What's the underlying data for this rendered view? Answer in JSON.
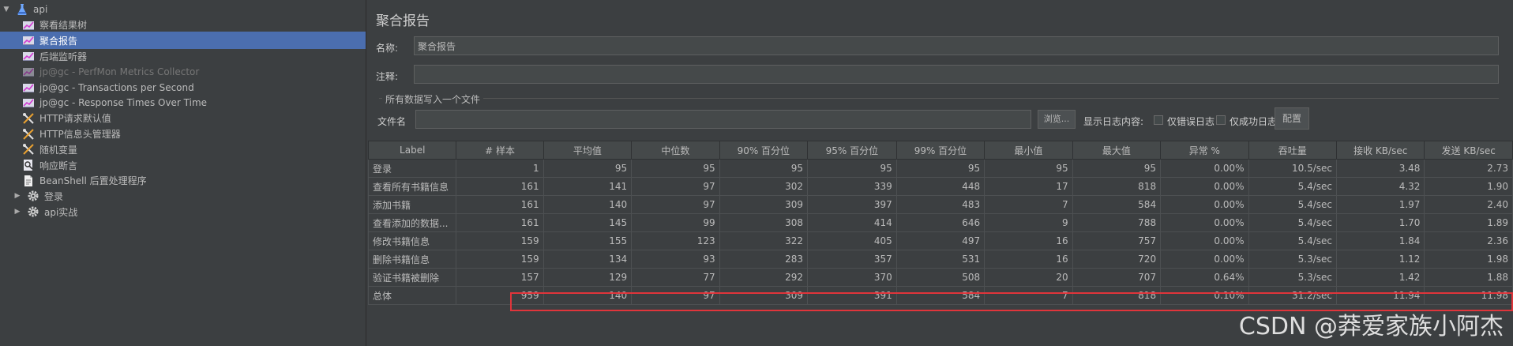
{
  "tree": [
    {
      "label": "api",
      "icon": "flask-icon",
      "name": "tree-root-api",
      "toggle": "▼",
      "indent": 0,
      "selected": false,
      "disabled": false
    },
    {
      "label": "察看结果树",
      "icon": "listener-graph-icon",
      "name": "tree-item-view-results-tree",
      "toggle": "",
      "indent": 28,
      "selected": false,
      "disabled": false
    },
    {
      "label": "聚合报告",
      "icon": "listener-graph-icon",
      "name": "tree-item-aggregate-report",
      "toggle": "",
      "indent": 28,
      "selected": true,
      "disabled": false
    },
    {
      "label": "后端监听器",
      "icon": "listener-graph-icon",
      "name": "tree-item-backend-listener",
      "toggle": "",
      "indent": 28,
      "selected": false,
      "disabled": false
    },
    {
      "label": "jp@gc - PerfMon Metrics Collector",
      "icon": "listener-graph-icon",
      "name": "tree-item-perfmon-collector",
      "toggle": "",
      "indent": 28,
      "selected": false,
      "disabled": true
    },
    {
      "label": "jp@gc - Transactions per Second",
      "icon": "listener-graph-icon",
      "name": "tree-item-transactions-per-second",
      "toggle": "",
      "indent": 28,
      "selected": false,
      "disabled": false
    },
    {
      "label": "jp@gc - Response Times Over Time",
      "icon": "listener-graph-icon",
      "name": "tree-item-response-times",
      "toggle": "",
      "indent": 28,
      "selected": false,
      "disabled": false
    },
    {
      "label": "HTTP请求默认值",
      "icon": "config-tools-icon",
      "name": "tree-item-http-defaults",
      "toggle": "",
      "indent": 28,
      "selected": false,
      "disabled": false
    },
    {
      "label": "HTTP信息头管理器",
      "icon": "config-tools-icon",
      "name": "tree-item-http-header-manager",
      "toggle": "",
      "indent": 28,
      "selected": false,
      "disabled": false
    },
    {
      "label": "随机变量",
      "icon": "config-tools-icon",
      "name": "tree-item-random-variable",
      "toggle": "",
      "indent": 28,
      "selected": false,
      "disabled": false
    },
    {
      "label": "响应断言",
      "icon": "assertion-icon",
      "name": "tree-item-response-assertion",
      "toggle": "",
      "indent": 28,
      "selected": false,
      "disabled": false
    },
    {
      "label": "BeanShell 后置处理程序",
      "icon": "script-icon",
      "name": "tree-item-beanshell-postprocessor",
      "toggle": "",
      "indent": 28,
      "selected": false,
      "disabled": false
    },
    {
      "label": "登录",
      "icon": "gear-icon",
      "name": "tree-item-login-group",
      "toggle": "▶",
      "indent": 16,
      "selected": false,
      "disabled": false
    },
    {
      "label": "api实战",
      "icon": "gear-icon",
      "name": "tree-item-api-practice-group",
      "toggle": "▶",
      "indent": 16,
      "selected": false,
      "disabled": false
    }
  ],
  "panel": {
    "title": "聚合报告",
    "name_label": "名称:",
    "name_value": "聚合报告",
    "comment_label": "注释:",
    "comment_value": "",
    "write_section": "所有数据写入一个文件",
    "filename_label": "文件名",
    "filename_value": "",
    "browse_button": "浏览...",
    "log_content_label": "显示日志内容:",
    "errors_only_label": "仅错误日志",
    "success_only_label": "仅成功日志",
    "configure_button": "配置"
  },
  "table": {
    "headers": [
      "Label",
      "# 样本",
      "平均值",
      "中位数",
      "90% 百分位",
      "95% 百分位",
      "99% 百分位",
      "最小值",
      "最大值",
      "异常 %",
      "吞吐量",
      "接收 KB/sec",
      "发送 KB/sec"
    ],
    "rows": [
      [
        "登录",
        "1",
        "95",
        "95",
        "95",
        "95",
        "95",
        "95",
        "95",
        "0.00%",
        "10.5/sec",
        "3.48",
        "2.73"
      ],
      [
        "查看所有书籍信息",
        "161",
        "141",
        "97",
        "302",
        "339",
        "448",
        "17",
        "818",
        "0.00%",
        "5.4/sec",
        "4.32",
        "1.90"
      ],
      [
        "添加书籍",
        "161",
        "140",
        "97",
        "309",
        "397",
        "483",
        "7",
        "584",
        "0.00%",
        "5.4/sec",
        "1.97",
        "2.40"
      ],
      [
        "查看添加的数据...",
        "161",
        "145",
        "99",
        "308",
        "414",
        "646",
        "9",
        "788",
        "0.00%",
        "5.4/sec",
        "1.70",
        "1.89"
      ],
      [
        "修改书籍信息",
        "159",
        "155",
        "123",
        "322",
        "405",
        "497",
        "16",
        "757",
        "0.00%",
        "5.4/sec",
        "1.84",
        "2.36"
      ],
      [
        "删除书籍信息",
        "159",
        "134",
        "93",
        "283",
        "357",
        "531",
        "16",
        "720",
        "0.00%",
        "5.3/sec",
        "1.12",
        "1.98"
      ],
      [
        "验证书籍被删除",
        "157",
        "129",
        "77",
        "292",
        "370",
        "508",
        "20",
        "707",
        "0.64%",
        "5.3/sec",
        "1.42",
        "1.88"
      ],
      [
        "总体",
        "959",
        "140",
        "97",
        "309",
        "391",
        "584",
        "7",
        "818",
        "0.10%",
        "31.2/sec",
        "11.94",
        "11.98"
      ]
    ]
  },
  "watermark": "CSDN @莽爱家族小阿杰",
  "colors": {
    "selected": "#4b6eaf",
    "highlight": "#e0353b",
    "background": "#3c3f41"
  }
}
